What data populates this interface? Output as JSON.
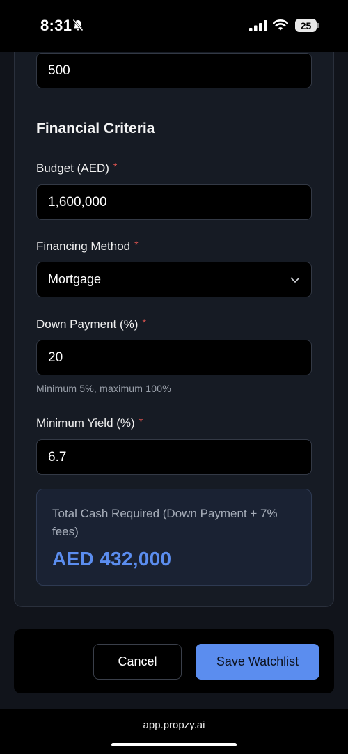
{
  "status_bar": {
    "time": "8:31",
    "battery": "25",
    "icons": [
      "bell-slash-icon",
      "signal-icon",
      "wifi-icon",
      "battery-icon"
    ]
  },
  "form": {
    "top_input_value": "500",
    "section_title": "Financial Criteria",
    "budget": {
      "label": "Budget (AED)",
      "required": "*",
      "value": "1,600,000"
    },
    "financing": {
      "label": "Financing Method",
      "required": "*",
      "value": "Mortgage"
    },
    "down_payment": {
      "label": "Down Payment (%)",
      "required": "*",
      "value": "20",
      "hint": "Minimum 5%, maximum 100%"
    },
    "min_yield": {
      "label": "Minimum Yield (%)",
      "required": "*",
      "value": "6.7"
    },
    "summary": {
      "label": "Total Cash Required (Down Payment + 7% fees)",
      "value": "AED 432,000"
    }
  },
  "actions": {
    "cancel_label": "Cancel",
    "save_label": "Save Watchlist"
  },
  "browser": {
    "url": "app.propzy.ai"
  },
  "colors": {
    "accent": "#5b8def",
    "required": "#d9534f",
    "card_bg": "#161b24",
    "page_bg": "#11141b"
  }
}
